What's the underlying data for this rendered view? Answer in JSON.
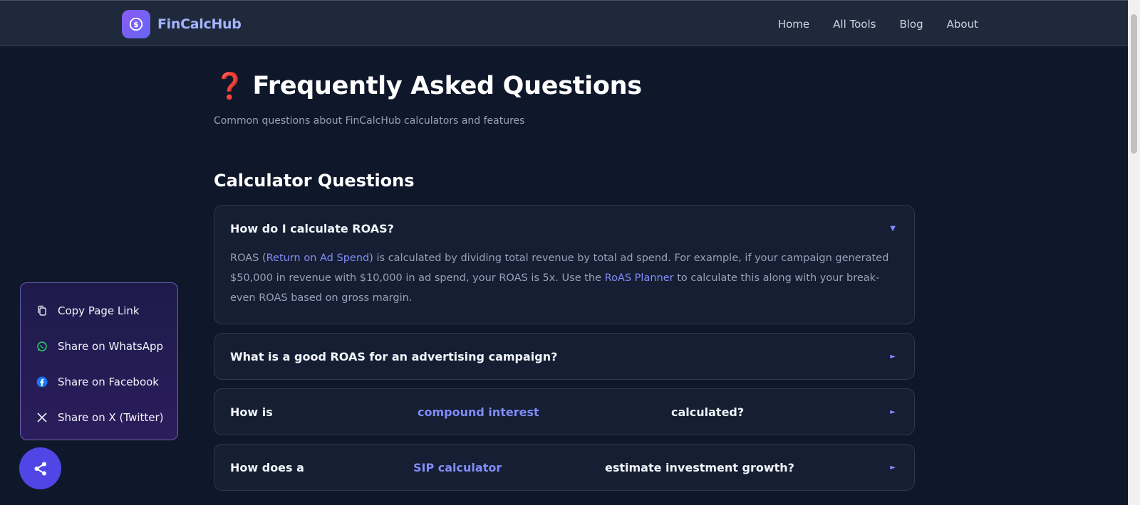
{
  "brand": {
    "name": "FinCalcHub"
  },
  "nav": {
    "items": [
      "Home",
      "All Tools",
      "Blog",
      "About"
    ]
  },
  "page": {
    "title": "Frequently Asked Questions",
    "subtitle": "Common questions about FinCalcHub calculators and features"
  },
  "section": {
    "title": "Calculator Questions"
  },
  "faqs": {
    "q1": {
      "question": "How do I calculate ROAS?",
      "arrow": "▼",
      "answer": {
        "p1": "ROAS (",
        "link1": "Return on Ad Spend",
        "p2": ") is calculated by dividing total revenue by total ad spend. For example, if your campaign generated $50,000 in revenue with $10,000 in ad spend, your ROAS is 5x. Use the ",
        "link2": "RoAS Planner",
        "p3": " to calculate this along with your break-even ROAS based on gross margin."
      }
    },
    "q2": {
      "question": "What is a good ROAS for an advertising campaign?",
      "arrow": "►"
    },
    "q3": {
      "part1": "How is",
      "link": "compound interest",
      "part2": "calculated?",
      "arrow": "►"
    },
    "q4": {
      "part1": "How does a",
      "link": "SIP calculator",
      "part2": "estimate investment growth?",
      "arrow": "►"
    }
  },
  "share": {
    "items": [
      "Copy Page Link",
      "Share on WhatsApp",
      "Share on Facebook",
      "Share on X (Twitter)"
    ]
  },
  "colors": {
    "accent": "#818cf8",
    "background": "#0f172a",
    "fab": "#4f46e5",
    "whatsapp": "#25d366",
    "facebook": "#1877f2"
  }
}
